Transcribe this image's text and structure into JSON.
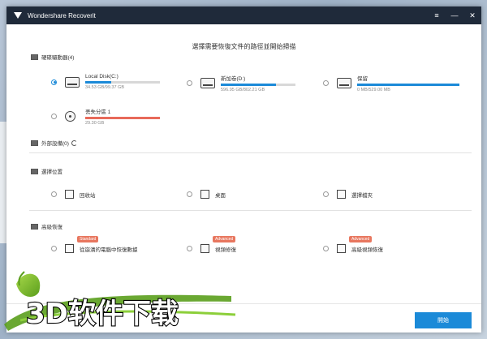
{
  "window": {
    "title": "Wondershare Recoverit",
    "controls": {
      "menu": "≡",
      "minimize": "—",
      "close": "✕"
    }
  },
  "heading": "選擇需要恢復文件的路徑並開始掃描",
  "sections": {
    "hard_drives": {
      "label": "硬碟驅動器(4)"
    },
    "external": {
      "label": "外部設備(0)"
    },
    "location": {
      "label": "選擇位置"
    },
    "advanced": {
      "label": "高級恢復"
    }
  },
  "drives": [
    {
      "name": "Local Disk(C:)",
      "size": "34.53 GB/99.37 GB",
      "usage": 0.35,
      "selected": true,
      "color": "#1b8ad8"
    },
    {
      "name": "新加卷(D:)",
      "size": "596.95 GB/802.21 GB",
      "usage": 0.74,
      "selected": false,
      "color": "#1b8ad8"
    },
    {
      "name": "保留",
      "size": "0 MB/529.00 MB",
      "usage": 1.0,
      "selected": false,
      "color": "#1b8ad8"
    },
    {
      "name": "丟失分區 1",
      "size": "29.30 GB",
      "usage": 1.0,
      "selected": false,
      "color": "#e86a5a"
    }
  ],
  "locations": [
    {
      "label": "回收站",
      "icon": "trash-icon"
    },
    {
      "label": "桌面",
      "icon": "desktop-icon"
    },
    {
      "label": "選擇檔夾",
      "icon": "folder-icon"
    }
  ],
  "advanced": [
    {
      "label": "從崩潰的電腦中恢復數據",
      "badge": "Standard",
      "icon": "crashed-pc-icon"
    },
    {
      "label": "視頻修復",
      "badge": "Advanced",
      "icon": "video-repair-icon"
    },
    {
      "label": "高級視頻恢復",
      "badge": "Advanced",
      "icon": "advanced-video-icon"
    }
  ],
  "footer": {
    "start_label": "開始"
  },
  "watermark": {
    "text": "3D软件下载"
  },
  "colors": {
    "accent": "#1b8ad8",
    "titlebar": "#1f2a3a",
    "badge": "#e8775f",
    "lost": "#e86a5a"
  }
}
